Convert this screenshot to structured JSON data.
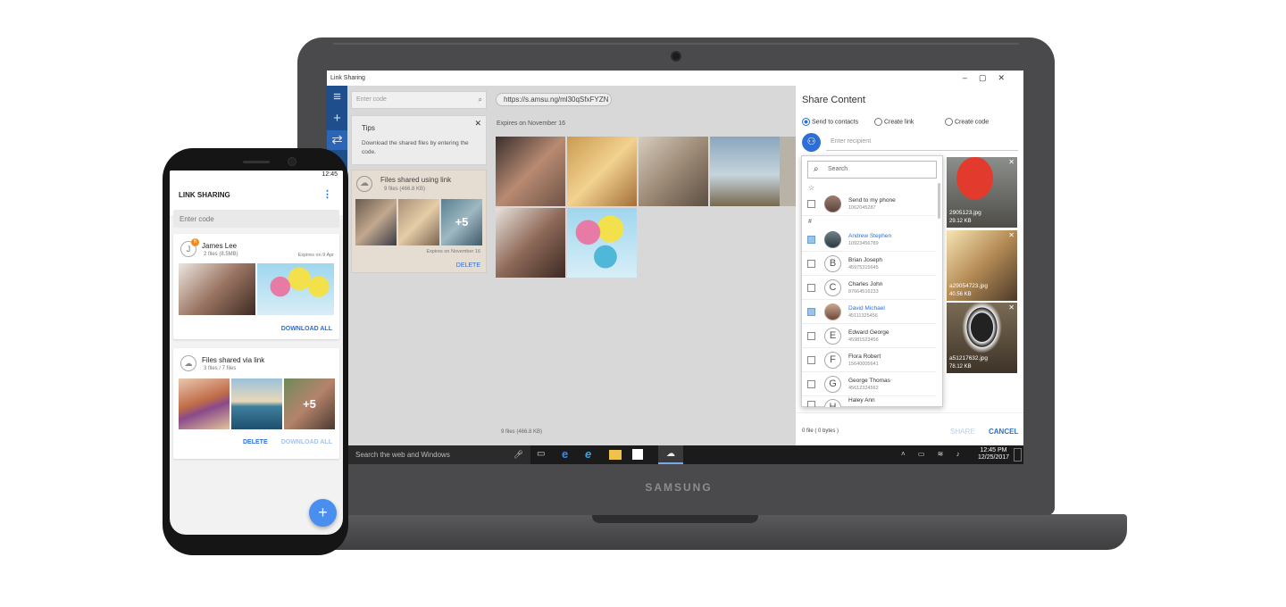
{
  "laptop": {
    "brand": "SAMSUNG",
    "window_title": "Link Sharing",
    "window_controls": [
      "–",
      "▢",
      "✕"
    ],
    "left": {
      "code_placeholder": "Enter code",
      "tips_title": "Tips",
      "tips_body": "Download the shared files by entering the code.",
      "card_title": "Files shared using link",
      "card_meta": "9 files  (466.8 KB)",
      "card_plus": "+5",
      "card_expiry": "Expires on November 16",
      "card_delete": "DELETE"
    },
    "middle": {
      "url": "https://s.amsu.ng/ml30qSfxFYZN",
      "expires": "Expires on November 16",
      "footer": "9 files  (466.8 KB)"
    },
    "share": {
      "title": "Share Content",
      "opt_contacts": "Send to contacts",
      "opt_link": "Create link",
      "opt_code": "Create code",
      "recipient_placeholder": "Enter recipient",
      "search_placeholder": "Search",
      "section_star": "☆",
      "section_hash": "#",
      "contacts": [
        {
          "name": "Send to my phone",
          "num": "1062045287",
          "checked": false
        },
        {
          "name": "Andrew Stephen",
          "num": "10923456789",
          "checked": true
        },
        {
          "name": "Brian Joseph",
          "num": "45975315645",
          "checked": false
        },
        {
          "name": "Charles John",
          "num": "87664516233",
          "checked": false
        },
        {
          "name": "David Michael",
          "num": "45111325456",
          "checked": true
        },
        {
          "name": "Edward George",
          "num": "45981523456",
          "checked": false
        },
        {
          "name": "Flora Robert",
          "num": "15640005641",
          "checked": false
        },
        {
          "name": "George Thomas",
          "num": "45612324562",
          "checked": false
        },
        {
          "name": "Haley Ann",
          "num": "",
          "checked": false
        }
      ],
      "thumbs": [
        {
          "name": "2905123.jpg",
          "size": "29.12 KB"
        },
        {
          "name": "a29054723.jpg",
          "size": "40.56 KB"
        },
        {
          "name": "a51217632.jpg",
          "size": "78.12 KB"
        }
      ],
      "footer_count": "0 file ( 0 bytes )",
      "share_btn": "SHARE",
      "cancel_btn": "CANCEL"
    },
    "taskbar": {
      "search": "Search the web and Windows",
      "time": "12:45 PM",
      "date": "12/25/2017"
    }
  },
  "phone": {
    "time": "12:45",
    "app_title": "LINK SHARING",
    "code_placeholder": "Enter code",
    "card1": {
      "avatar": "J",
      "badge": "6",
      "name": "James Lee",
      "meta": "2 files (8.5MB)",
      "expiry": "Expires on 9 Apr",
      "download": "DOWNLOAD ALL"
    },
    "card2": {
      "title": "Files shared via link",
      "meta": "3 files / 7 files",
      "plus": "+5",
      "delete": "DELETE",
      "download": "DOWNLOAD ALL"
    },
    "fab": "+"
  },
  "colors": {
    "accent": "#2d6fd6",
    "rail": "#1f4e8c",
    "laptop": "#4a4a4c"
  }
}
